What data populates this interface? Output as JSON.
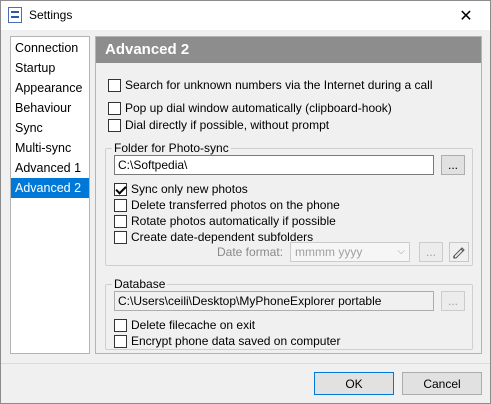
{
  "window": {
    "title": "Settings",
    "close_glyph": "✕"
  },
  "nav": {
    "items": [
      "Connection",
      "Startup",
      "Appearance",
      "Behaviour",
      "Sync",
      "Multi-sync",
      "Advanced 1",
      "Advanced 2"
    ],
    "active_index": 7
  },
  "panel": {
    "title": "Advanced 2",
    "options": {
      "search_unknown": {
        "label": "Search for unknown numbers via the Internet during a call",
        "checked": false
      },
      "popup_dial": {
        "label": "Pop up dial window automatically (clipboard-hook)",
        "checked": false
      },
      "dial_directly": {
        "label": "Dial directly if possible, without prompt",
        "checked": false
      }
    },
    "photo_sync": {
      "legend": "Folder for Photo-sync",
      "path": "C:\\Softpedia\\",
      "browse_label": "...",
      "sync_new": {
        "label": "Sync only new photos",
        "checked": true
      },
      "delete_transferred": {
        "label": "Delete transferred photos on the phone",
        "checked": false
      },
      "rotate_auto": {
        "label": "Rotate photos automatically if possible",
        "checked": false
      },
      "date_subfolders": {
        "label": "Create date-dependent subfolders",
        "checked": false
      },
      "date_format_label": "Date format:",
      "date_format_value": "mmmm yyyy",
      "dots_label": "...",
      "edit_icon": "pencil-icon"
    },
    "database": {
      "legend": "Database",
      "path": "C:\\Users\\ceili\\Desktop\\MyPhoneExplorer portable",
      "browse_label": "...",
      "delete_filecache": {
        "label": "Delete filecache on exit",
        "checked": false
      },
      "encrypt": {
        "label": "Encrypt phone data saved on computer",
        "checked": false
      }
    }
  },
  "footer": {
    "ok_label": "OK",
    "cancel_label": "Cancel"
  }
}
